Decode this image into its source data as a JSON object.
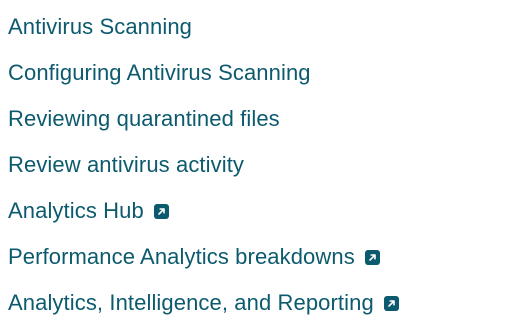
{
  "links": [
    {
      "label": "Antivirus Scanning",
      "external": false
    },
    {
      "label": "Configuring Antivirus Scanning",
      "external": false
    },
    {
      "label": "Reviewing quarantined files",
      "external": false
    },
    {
      "label": "Review antivirus activity",
      "external": false
    },
    {
      "label": "Analytics Hub",
      "external": true
    },
    {
      "label": "Performance Analytics breakdowns",
      "external": true
    },
    {
      "label": "Analytics, Intelligence, and Reporting",
      "external": true
    }
  ],
  "icons": {
    "external": "external-link-icon"
  },
  "colors": {
    "link": "#0c5a6e",
    "background": "#ffffff"
  }
}
